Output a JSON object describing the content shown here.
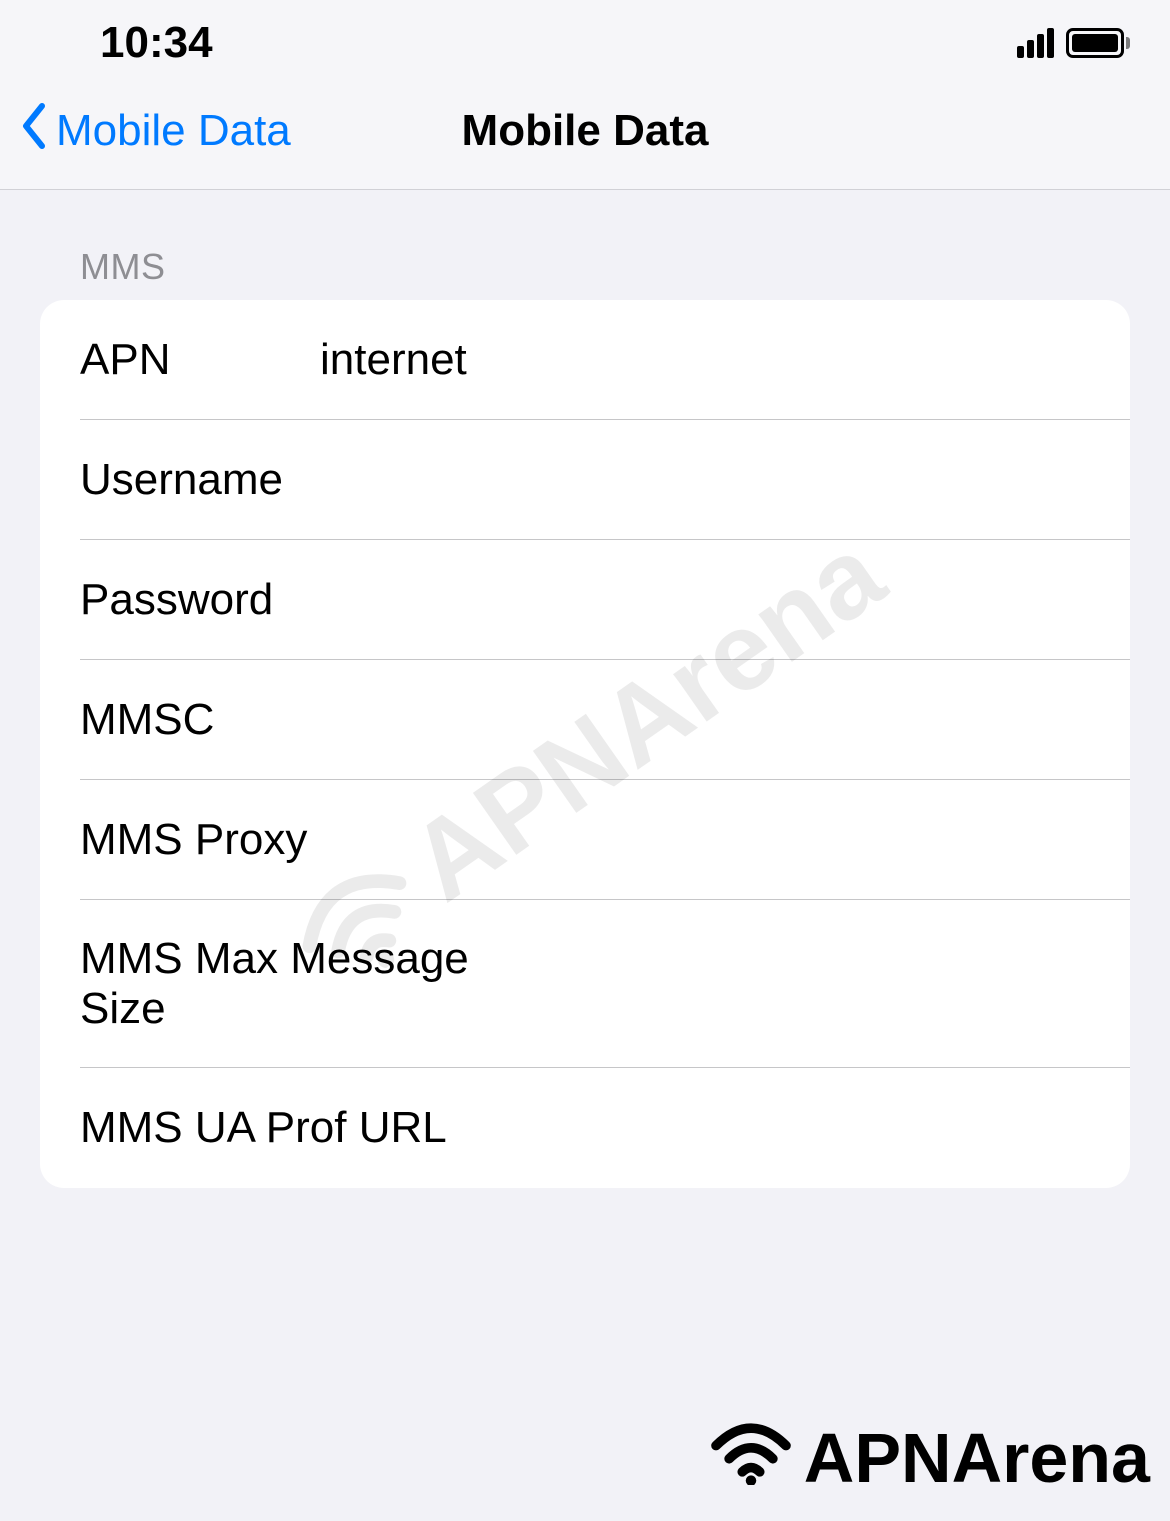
{
  "status": {
    "time": "10:34"
  },
  "nav": {
    "back_label": "Mobile Data",
    "title": "Mobile Data"
  },
  "section": {
    "header": "MMS"
  },
  "fields": [
    {
      "label": "APN",
      "value": "internet"
    },
    {
      "label": "Username",
      "value": ""
    },
    {
      "label": "Password",
      "value": ""
    },
    {
      "label": "MMSC",
      "value": ""
    },
    {
      "label": "MMS Proxy",
      "value": ""
    },
    {
      "label": "MMS Max Message Size",
      "value": ""
    },
    {
      "label": "MMS UA Prof URL",
      "value": ""
    }
  ],
  "branding": {
    "watermark": "APNArena",
    "footer": "APNArena"
  }
}
